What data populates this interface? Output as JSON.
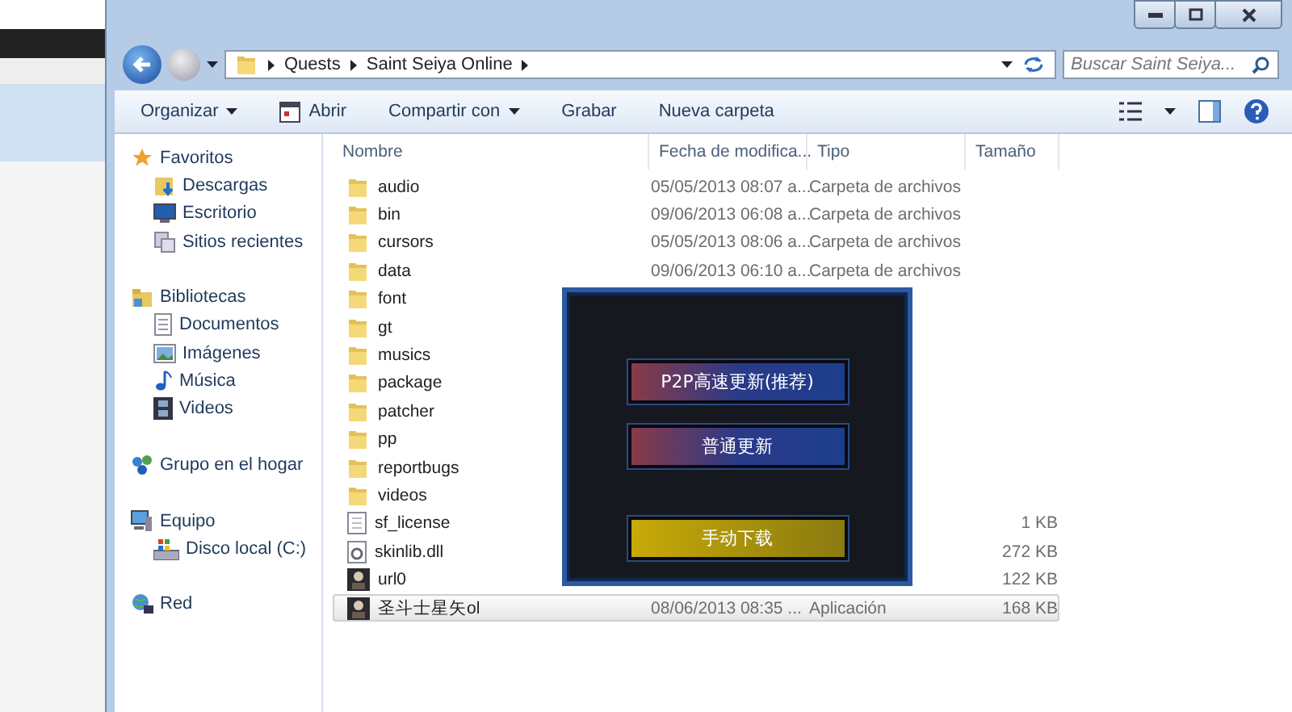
{
  "address": {
    "crumbs": [
      "Quests",
      "Saint Seiya Online"
    ]
  },
  "search": {
    "placeholder": "Buscar Saint Seiya..."
  },
  "toolbar": {
    "buttons": [
      {
        "label": "Organizar",
        "kind": "menu"
      },
      {
        "label": "Abrir",
        "kind": "icon"
      },
      {
        "label": "Compartir con",
        "kind": "menu"
      },
      {
        "label": "Grabar",
        "kind": "plain"
      },
      {
        "label": "Nueva carpeta",
        "kind": "plain"
      }
    ]
  },
  "sidebar": {
    "groups": [
      {
        "label": "Favoritos",
        "kind": "star",
        "children": [
          {
            "label": "Descargas",
            "kind": "download"
          },
          {
            "label": "Escritorio",
            "kind": "desktop"
          },
          {
            "label": "Sitios recientes",
            "kind": "recent"
          }
        ]
      },
      {
        "label": "Bibliotecas",
        "kind": "library",
        "children": [
          {
            "label": "Documentos",
            "kind": "document"
          },
          {
            "label": "Imágenes",
            "kind": "image"
          },
          {
            "label": "Música",
            "kind": "music"
          },
          {
            "label": "Videos",
            "kind": "video"
          }
        ]
      },
      {
        "label": "Grupo en el hogar",
        "kind": "homegroup"
      },
      {
        "label": "Equipo",
        "kind": "computer",
        "children": [
          {
            "label": "Disco local (C:)",
            "kind": "disk"
          }
        ]
      },
      {
        "label": "Red",
        "kind": "network"
      }
    ]
  },
  "table": {
    "columns": [
      "Nombre",
      "Fecha de modifica...",
      "Tipo",
      "Tamaño"
    ],
    "rows": [
      {
        "name": "audio",
        "kind": "folder",
        "modified": "05/05/2013 08:07 a...",
        "type": "Carpeta de archivos",
        "selected": false
      },
      {
        "name": "bin",
        "kind": "folder",
        "modified": "09/06/2013 06:08 a...",
        "type": "Carpeta de archivos",
        "selected": false
      },
      {
        "name": "cursors",
        "kind": "folder",
        "modified": "05/05/2013 08:06 a...",
        "type": "Carpeta de archivos",
        "selected": false
      },
      {
        "name": "data",
        "kind": "folder",
        "modified": "09/06/2013 06:10 a...",
        "type": "Carpeta de archivos",
        "selected": false
      },
      {
        "name": "font",
        "kind": "folder",
        "selected": false
      },
      {
        "name": "gt",
        "kind": "folder",
        "selected": false
      },
      {
        "name": "musics",
        "kind": "folder",
        "selected": false
      },
      {
        "name": "package",
        "kind": "folder",
        "selected": false
      },
      {
        "name": "patcher",
        "kind": "folder",
        "selected": false
      },
      {
        "name": "pp",
        "kind": "folder",
        "selected": false
      },
      {
        "name": "reportbugs",
        "kind": "folder",
        "selected": false
      },
      {
        "name": "videos",
        "kind": "folder",
        "selected": false
      },
      {
        "name": "sf_license",
        "kind": "text",
        "size": "1 KB",
        "selected": false
      },
      {
        "name": "skinlib.dll",
        "kind": "dll",
        "size": "272 KB",
        "selected": false
      },
      {
        "name": "url0",
        "kind": "app",
        "size": "122 KB",
        "selected": false
      },
      {
        "name": "圣斗士星矢ol",
        "kind": "app",
        "modified": "08/06/2013 08:35 ...",
        "type": "Aplicación",
        "size": "168 KB",
        "selected": true
      }
    ]
  },
  "dialog": {
    "buttons": [
      {
        "label": "P2P高速更新(推荐)",
        "kind": "blue"
      },
      {
        "label": "普通更新",
        "kind": "blue"
      },
      {
        "label": "手动下载",
        "kind": "gold"
      }
    ]
  }
}
